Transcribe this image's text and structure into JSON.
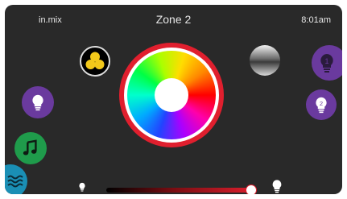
{
  "header": {
    "brand": "in.mix",
    "title": "Zone 2",
    "time": "8:01am"
  },
  "colors": {
    "background": "#292929",
    "accent_red": "#e01f2e",
    "purple": "#6a3a9e",
    "green": "#1f9b4b",
    "teal": "#1a8fb5",
    "yellow": "#f2c81a"
  },
  "icons": {
    "multi_color": "three-circles-icon",
    "gradient": "gradient-ball-icon",
    "zone1": "bulb-1-icon",
    "zone2": "bulb-2-icon",
    "light": "bulb-icon",
    "music": "music-note-icon",
    "water": "water-waves-icon",
    "dim": "bulb-dim-icon",
    "bright": "bulb-bright-icon"
  },
  "brightness": {
    "level": 0.97
  }
}
